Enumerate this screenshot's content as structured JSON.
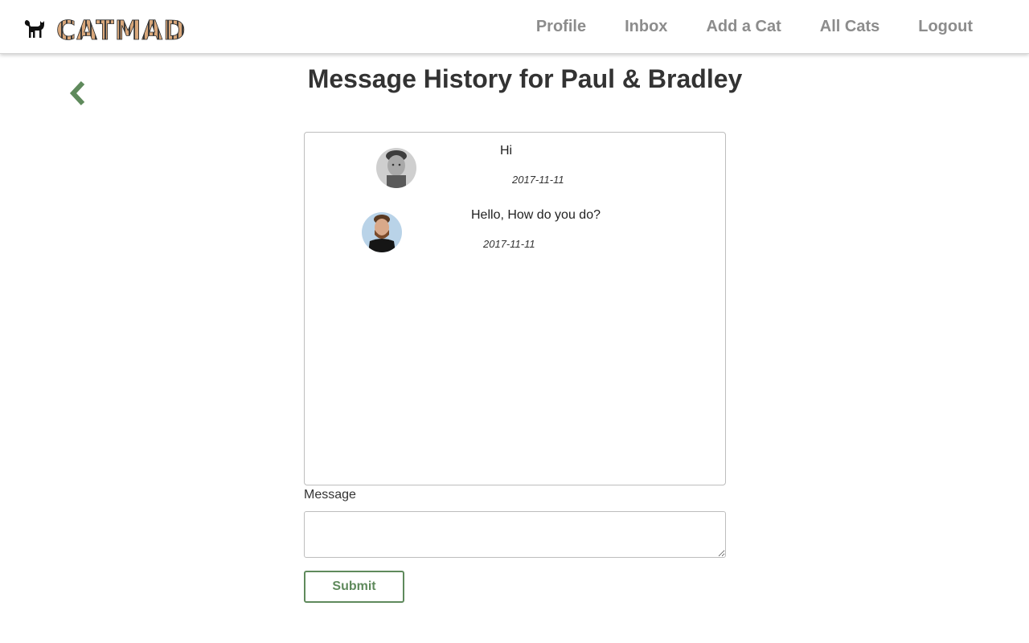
{
  "brand": {
    "name": "CATMAD",
    "logo_icon": "black-cat-icon",
    "colors": {
      "stripe_dark": "#3a3a3a",
      "stripe_light": "#d9a77a"
    }
  },
  "nav": {
    "profile": "Profile",
    "inbox": "Inbox",
    "add_cat": "Add a Cat",
    "all_cats": "All Cats",
    "logout": "Logout"
  },
  "back": {
    "icon": "chevron-left-icon"
  },
  "page_title": "Message History for Paul & Bradley",
  "messages": [
    {
      "text": "Hi",
      "date": "2017-11-11",
      "avatar": "grayscale-man-avatar"
    },
    {
      "text": "Hello, How do you do?",
      "date": "2017-11-11",
      "avatar": "bearded-man-avatar"
    }
  ],
  "form": {
    "label": "Message",
    "value": "",
    "submit_label": "Submit"
  },
  "colors": {
    "accent": "#5f8a5c",
    "nav_text": "#8c8c8c",
    "heading": "#333333",
    "border": "#bdbdbd"
  }
}
